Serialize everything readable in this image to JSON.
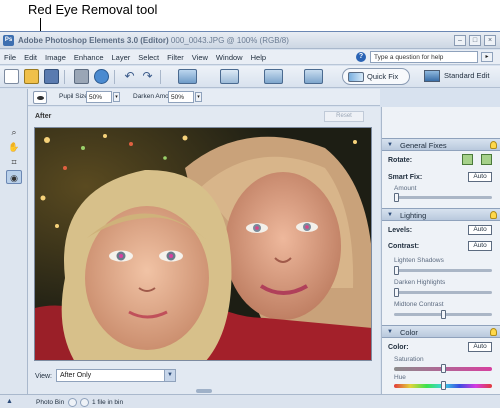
{
  "callout": {
    "text": "Red Eye Removal tool"
  },
  "window": {
    "app_title": "Adobe Photoshop Elements 3.0 (Editor)",
    "file_info": "000_0043.JPG @ 100% (RGB/8)",
    "minimize": "–",
    "maximize": "□",
    "close": "×"
  },
  "menu": {
    "items": [
      "File",
      "Edit",
      "Image",
      "Enhance",
      "Layer",
      "Select",
      "Filter",
      "View",
      "Window",
      "Help"
    ],
    "help_placeholder": "Type a question for help",
    "help_go": "▸"
  },
  "shortcuts": {
    "quick_fix": "Quick Fix",
    "standard_edit": "Standard Edit"
  },
  "options_bar": {
    "pupil_label": "Pupil Size:",
    "pupil_value": "50%",
    "darken_label": "Darken Amount:",
    "darken_value": "50%"
  },
  "canvas": {
    "after_label": "After",
    "reset": "Reset",
    "view_label": "View:",
    "view_value": "After Only"
  },
  "palette": {
    "general_fixes": "General Fixes",
    "rotate_label": "Rotate:",
    "smart_fix_label": "Smart Fix:",
    "amount_label": "Amount",
    "lighting": "Lighting",
    "levels_label": "Levels:",
    "contrast_label": "Contrast:",
    "lighten_shadows": "Lighten Shadows",
    "darken_highlights": "Darken Highlights",
    "midtone_contrast": "Midtone Contrast",
    "color": "Color",
    "color_label": "Color:",
    "saturation": "Saturation",
    "hue": "Hue",
    "temperature": "Temperature",
    "auto": "Auto",
    "slider_levels": {
      "amount": 0.0,
      "lighten_shadows": 0.0,
      "darken_highlights": 0.0,
      "midtone_contrast": 0.5,
      "saturation": 0.5,
      "hue": 0.5,
      "temperature": 0.5
    }
  },
  "status": {
    "photo_bin": "Photo Bin",
    "file_count": "1 file in bin"
  }
}
